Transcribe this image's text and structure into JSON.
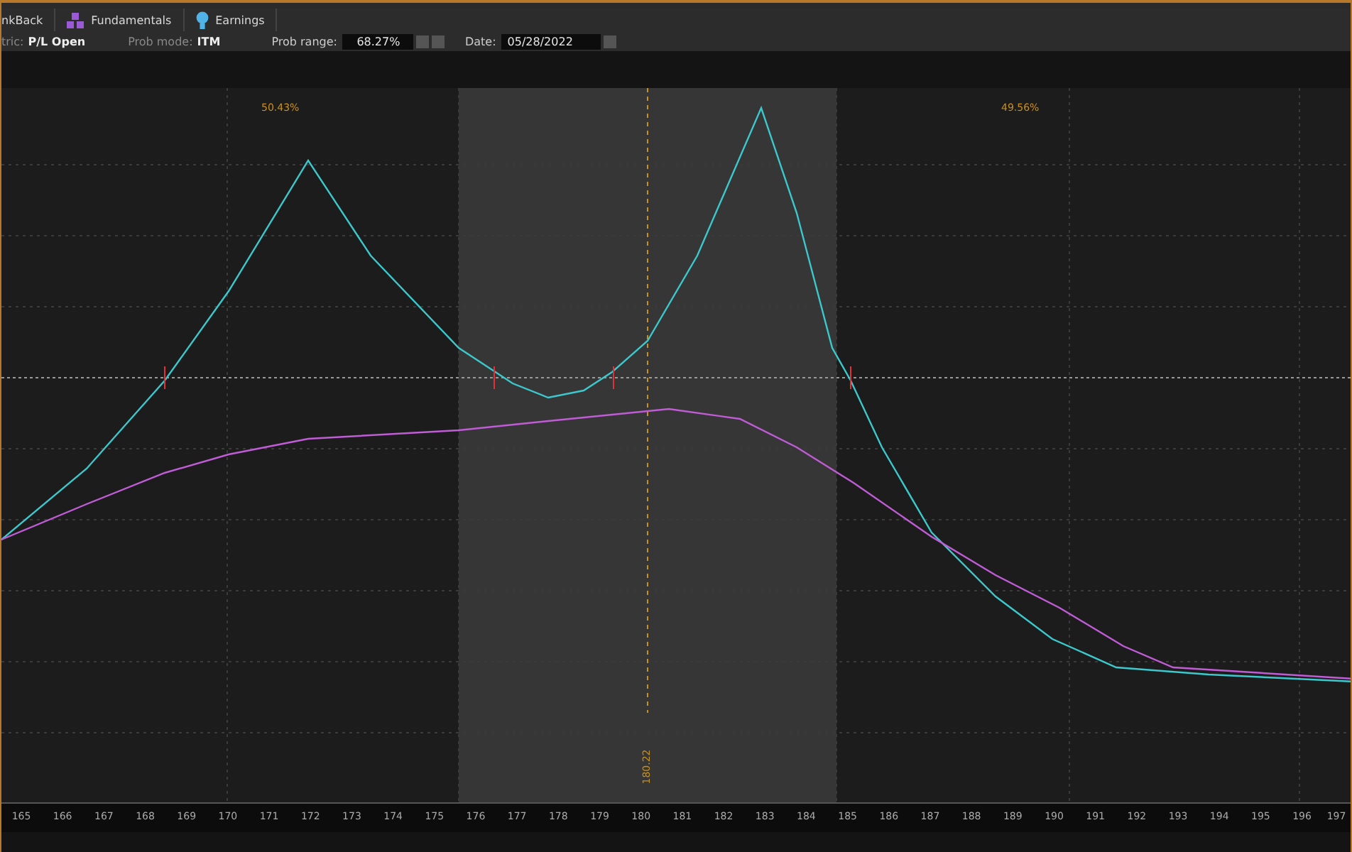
{
  "tabs": [
    {
      "label": "nkBack",
      "kind": "plain"
    },
    {
      "label": "Fundamentals",
      "kind": "fundamentals"
    },
    {
      "label": "Earnings",
      "kind": "earnings"
    }
  ],
  "settings": {
    "metric_label": "tric:",
    "metric_value": "P/L Open",
    "prob_mode_label": "Prob mode:",
    "prob_mode_value": "ITM",
    "prob_range_label": "Prob range:",
    "prob_range_value": "68.27%",
    "date_label": "Date:",
    "date_value": "05/28/2022"
  },
  "chart": {
    "left_probability": "50.43%",
    "right_probability": "49.56%",
    "price_marker": "180.22",
    "x_axis_labels": [
      "165",
      "166",
      "167",
      "168",
      "169",
      "170",
      "171",
      "172",
      "173",
      "174",
      "175",
      "176",
      "177",
      "178",
      "179",
      "180",
      "181",
      "182",
      "183",
      "184",
      "185",
      "186",
      "187",
      "188",
      "189",
      "190",
      "191",
      "192",
      "193",
      "194",
      "195",
      "196",
      "197"
    ]
  }
}
